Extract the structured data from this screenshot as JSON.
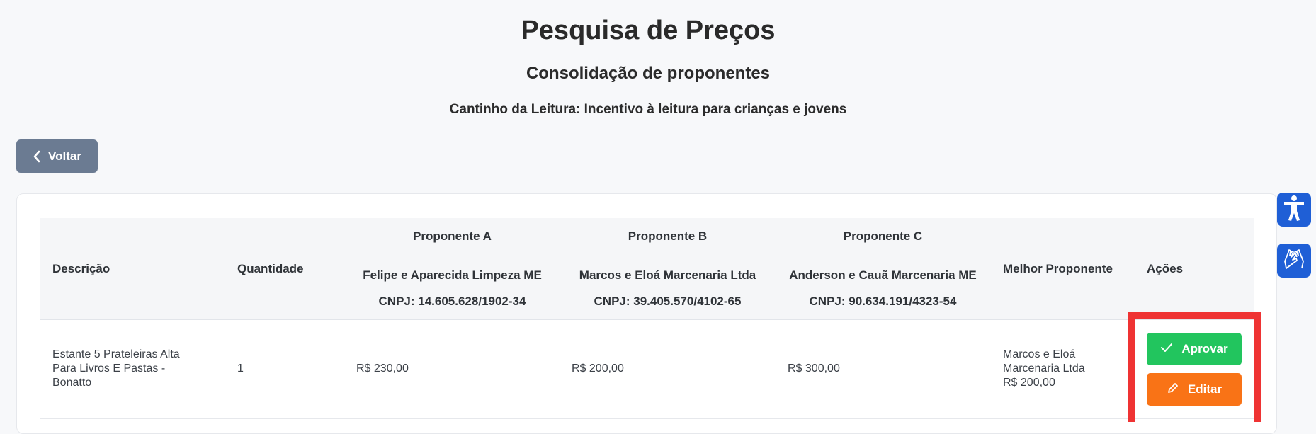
{
  "header": {
    "title": "Pesquisa de Preços",
    "subtitle": "Consolidação de proponentes",
    "project": "Cantinho da Leitura: Incentivo à leitura para crianças e jovens"
  },
  "back_button": {
    "label": "Voltar",
    "icon": "chevron-left-icon"
  },
  "table": {
    "columns": {
      "descricao": "Descrição",
      "quantidade": "Quantidade",
      "melhor": "Melhor Proponente",
      "acoes": "Ações"
    },
    "proponents": [
      {
        "group": "Proponente A",
        "name": "Felipe e Aparecida Limpeza ME",
        "cnpj": "CNPJ: 14.605.628/1902-34"
      },
      {
        "group": "Proponente B",
        "name": "Marcos e Eloá Marcenaria Ltda",
        "cnpj": "CNPJ: 39.405.570/4102-65"
      },
      {
        "group": "Proponente C",
        "name": "Anderson e Cauã Marcenaria ME",
        "cnpj": "CNPJ: 90.634.191/4323-54"
      }
    ],
    "rows": [
      {
        "descricao": "Estante 5 Prateleiras Alta Para Livros E Pastas - Bonatto",
        "quantidade": "1",
        "price_a": "R$ 230,00",
        "price_b": "R$ 200,00",
        "price_c": "R$ 300,00",
        "melhor_nome": "Marcos e Eloá Marcenaria Ltda",
        "melhor_valor": "R$ 200,00",
        "approve_label": "Aprovar",
        "edit_label": "Editar"
      }
    ]
  },
  "side_tools": [
    {
      "name": "accessibility-icon"
    },
    {
      "name": "sign-language-icon"
    }
  ],
  "colors": {
    "approve": "#22c55e",
    "edit": "#f97316",
    "back": "#6b7b92",
    "highlight": "#ef3333",
    "side_tool": "#1f5fd6"
  }
}
